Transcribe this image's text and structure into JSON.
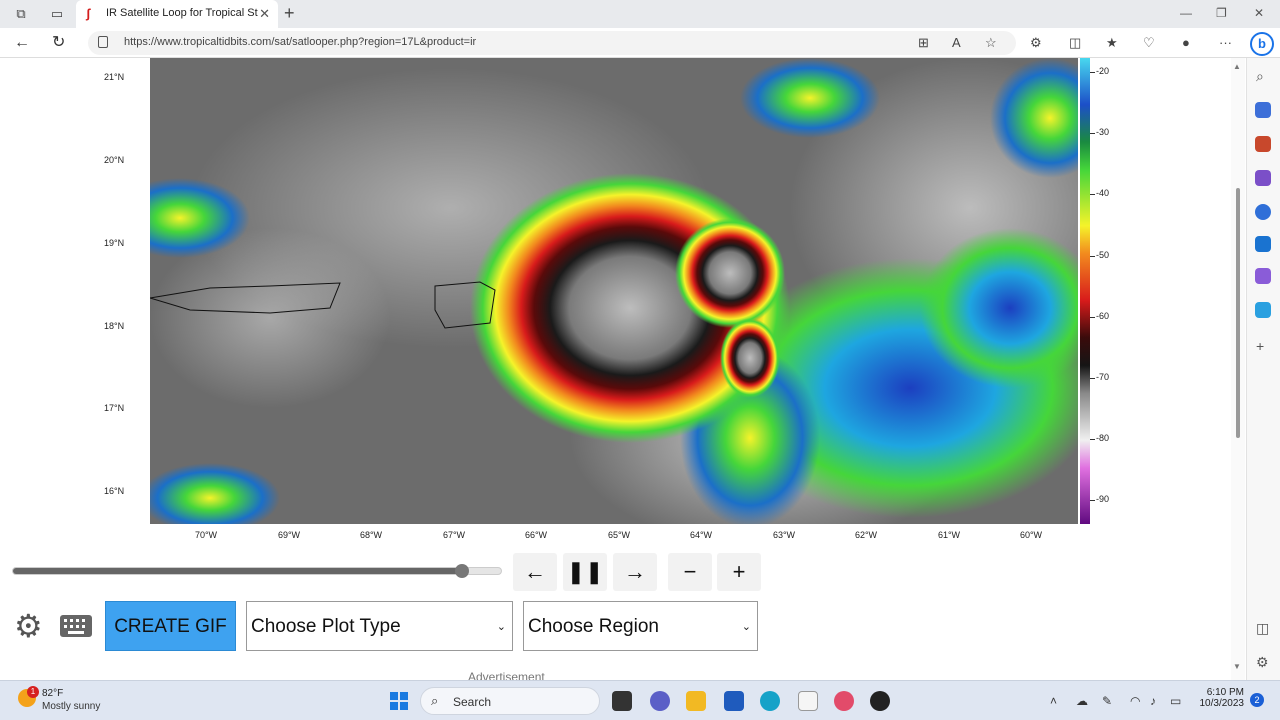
{
  "browser": {
    "tab_title": "IR Satellite Loop for Tropical Storm",
    "url": "https://www.tropicaltidbits.com/sat/satlooper.php?region=17L&product=ir"
  },
  "map": {
    "lat_labels": [
      "21°N",
      "20°N",
      "19°N",
      "18°N",
      "17°N",
      "16°N"
    ],
    "lon_labels": [
      "70°W",
      "69°W",
      "68°W",
      "67°W",
      "66°W",
      "65°W",
      "64°W",
      "63°W",
      "62°W",
      "61°W",
      "60°W"
    ],
    "colorbar_labels": [
      "-20",
      "-30",
      "-40",
      "-50",
      "-60",
      "-70",
      "-80",
      "-90"
    ]
  },
  "controls": {
    "slider_fraction": 0.92,
    "prev_icon": "arrow-left-icon",
    "pause_icon": "pause-icon",
    "next_icon": "arrow-right-icon",
    "zoom_out_icon": "minus-icon",
    "zoom_in_icon": "plus-icon",
    "create_gif": "CREATE GIF",
    "plot_type": "Choose Plot Type",
    "region": "Choose Region",
    "ad_label": "Advertisement"
  },
  "taskbar": {
    "temp": "82°F",
    "condition": "Mostly sunny",
    "weather_badge": "1",
    "search_label": "Search",
    "time": "6:10 PM",
    "date": "10/3/2023",
    "notification_count": "2"
  }
}
